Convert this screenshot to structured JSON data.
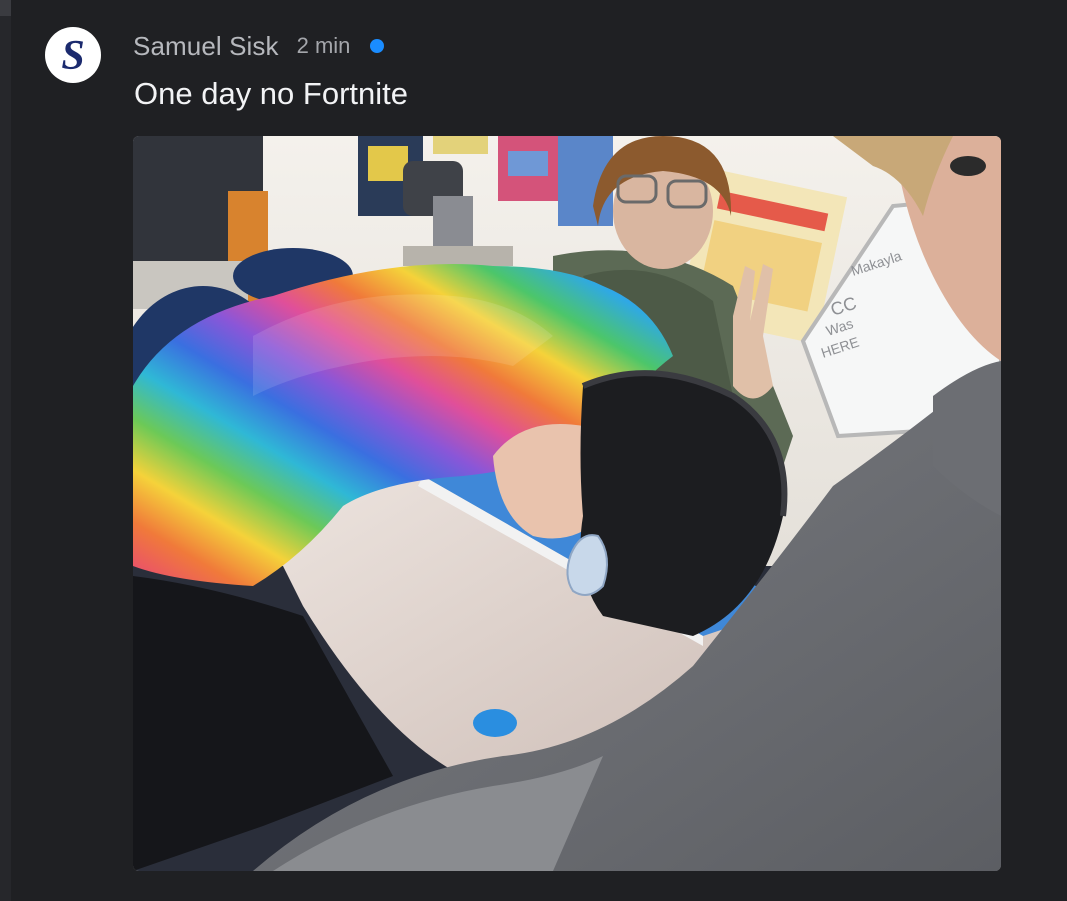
{
  "message": {
    "author": "Samuel Sisk",
    "time": "2 min",
    "text": "One day no Fortnite",
    "avatar": {
      "letter": "S",
      "letter_color": "#1b2a6e",
      "background": "#ffffff"
    },
    "unread_dot_color": "#1a8cff",
    "attachment": {
      "type": "photo",
      "sign_text": [
        "Makayla",
        "CC",
        "Was",
        "HERE"
      ]
    }
  },
  "colors": {
    "background": "#1f2023",
    "author_text": "#b6b8bd",
    "time_text": "#a4a6ab",
    "message_text": "#f2f3f5"
  }
}
